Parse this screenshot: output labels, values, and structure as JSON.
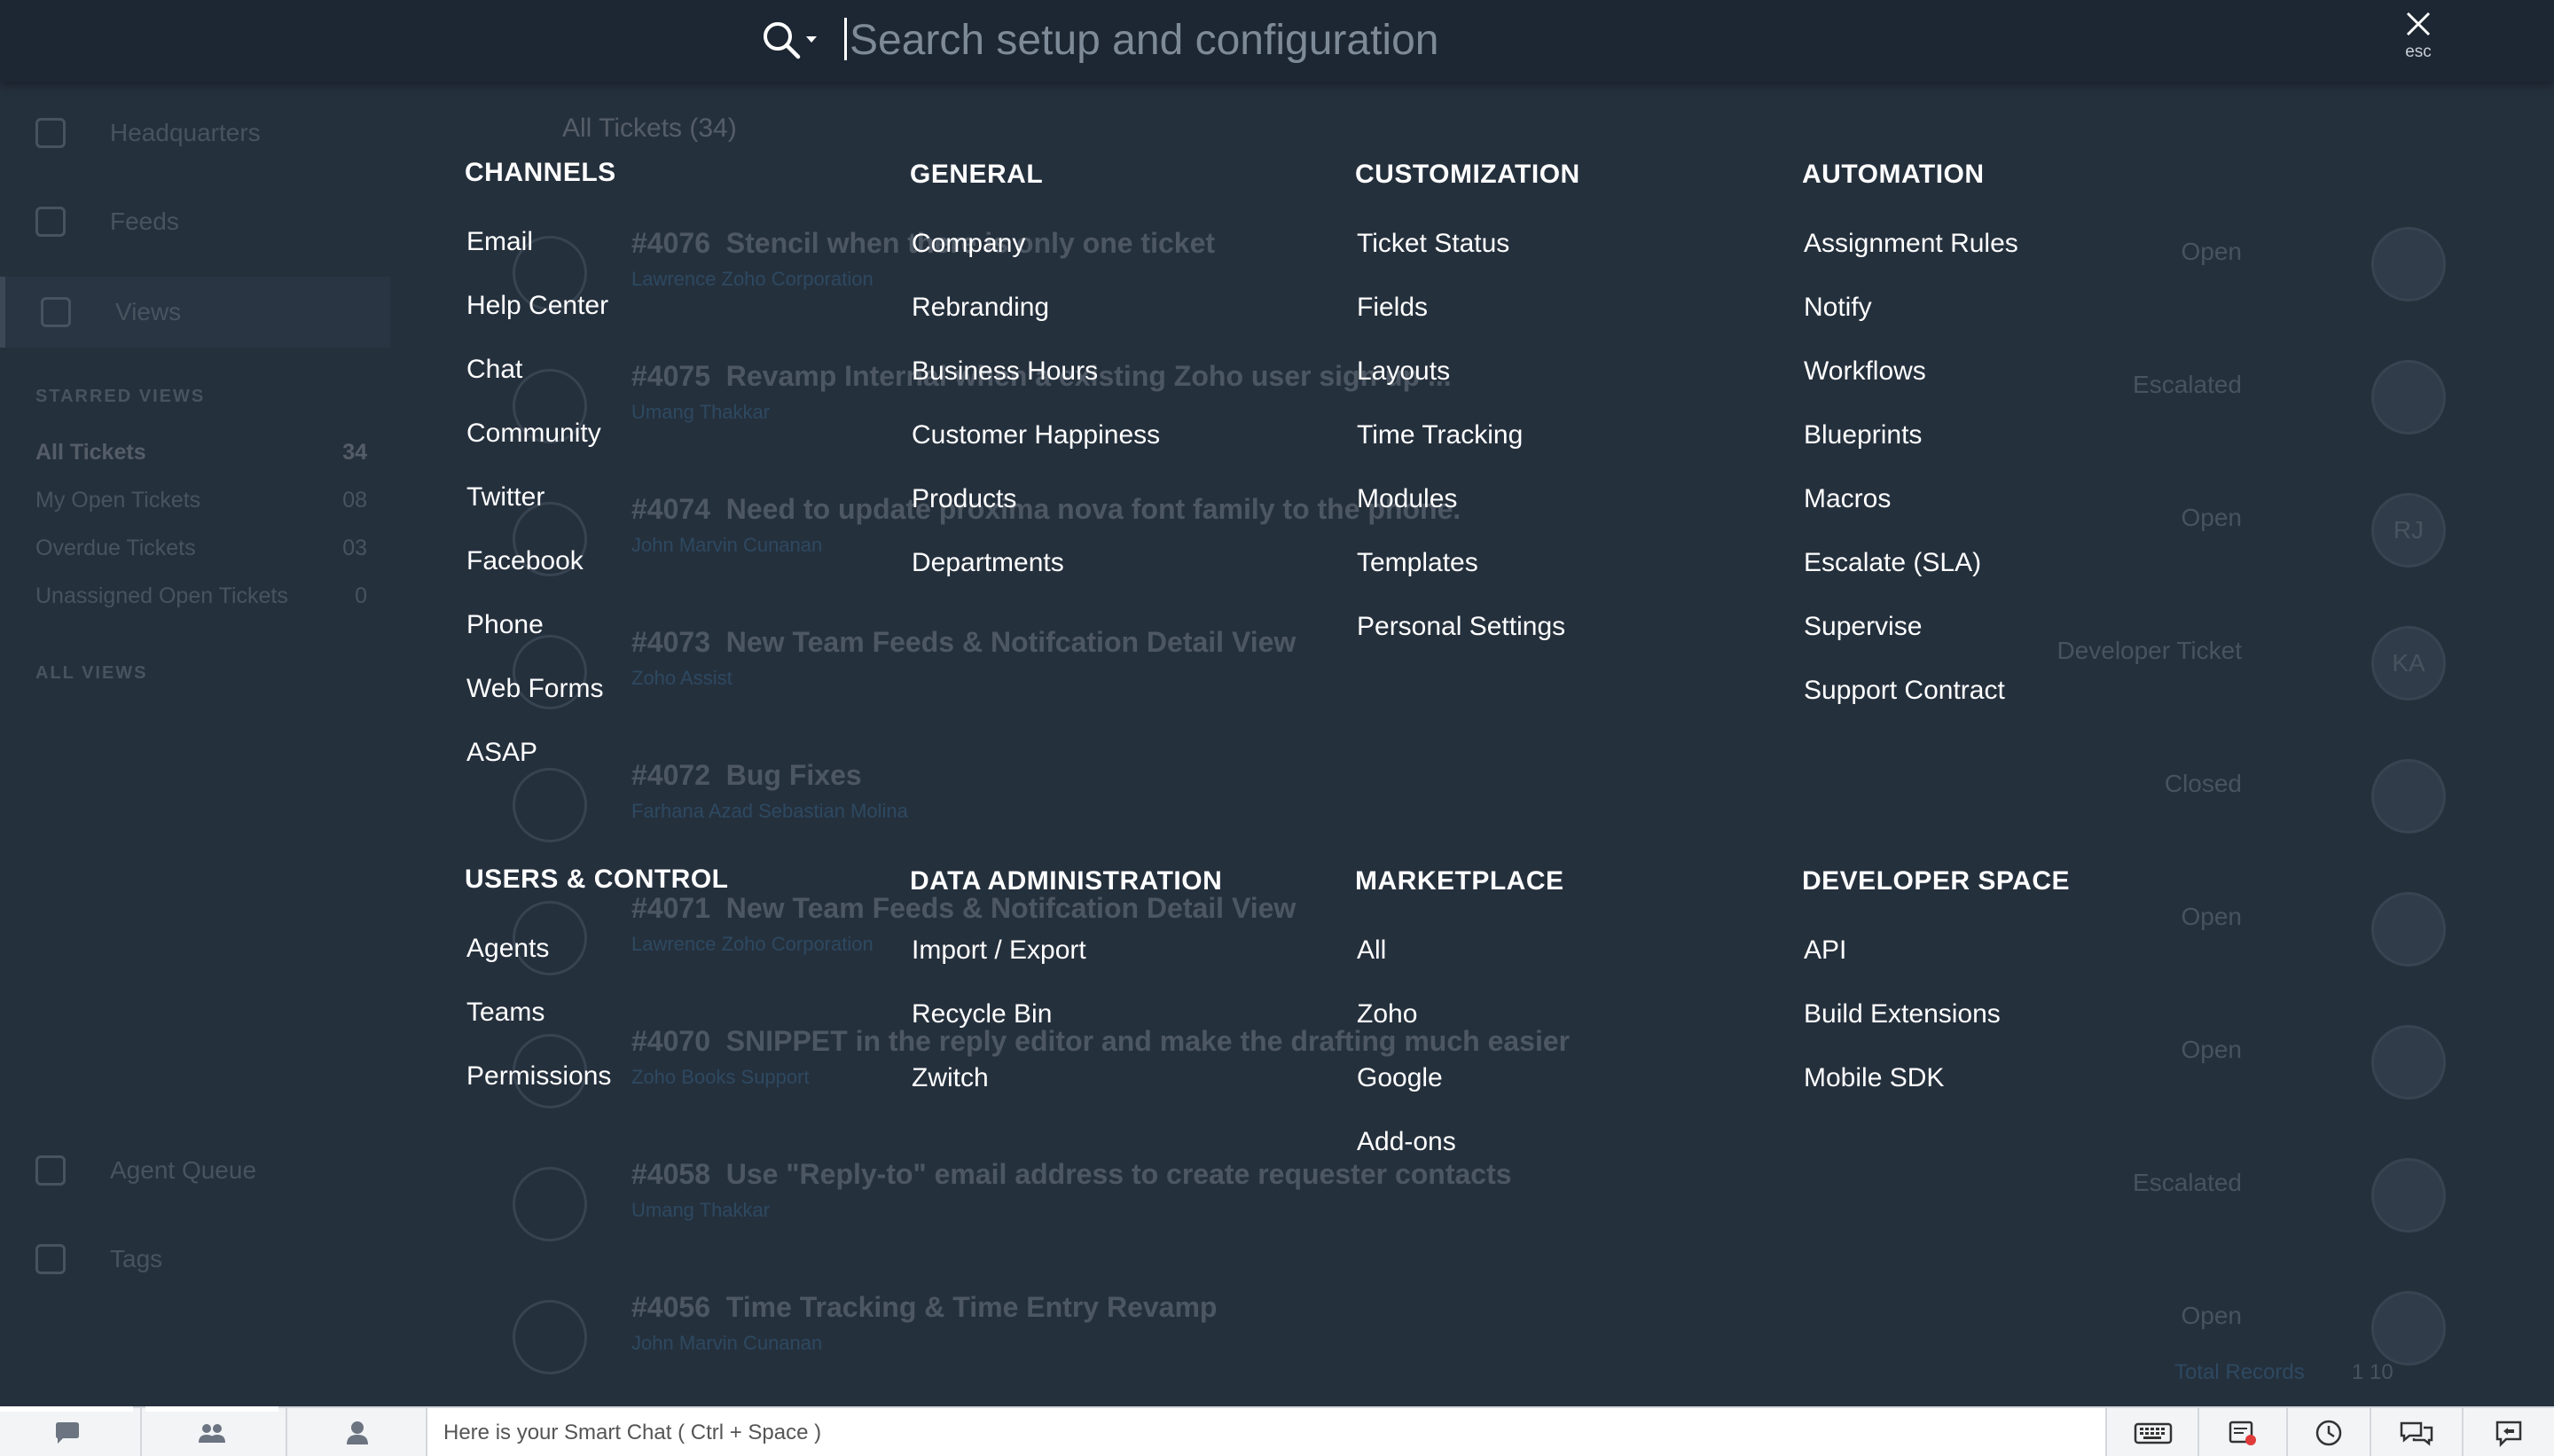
{
  "search": {
    "placeholder": "Search setup and configuration",
    "close_hint": "esc"
  },
  "background": {
    "nav": [
      "Headquarters",
      "Feeds",
      "Views"
    ],
    "starred_title": "STARRED VIEWS",
    "views": [
      {
        "label": "All Tickets",
        "count": "34"
      },
      {
        "label": "My Open Tickets",
        "count": "08"
      },
      {
        "label": "Overdue Tickets",
        "count": "03"
      },
      {
        "label": "Unassigned Open Tickets",
        "count": "0"
      }
    ],
    "all_views_title": "ALL VIEWS",
    "bottom_nav": [
      "Agent Queue",
      "Tags"
    ],
    "list_title": "All Tickets (34)",
    "tickets": [
      {
        "id": "#4076",
        "subject": "Stencil when there is only one ticket",
        "meta": "Lawrence   Zoho Corporation",
        "status": "Open",
        "avatar": ""
      },
      {
        "id": "#4075",
        "subject": "Revamp Internal when a existing Zoho user sign up ...",
        "meta": "Umang Thakkar",
        "status": "Escalated",
        "avatar": ""
      },
      {
        "id": "#4074",
        "subject": "Need to update proxima nova font family to the phone.",
        "meta": "John Marvin Cunanan",
        "status": "Open",
        "avatar": "RJ"
      },
      {
        "id": "#4073",
        "subject": "New Team Feeds & Notifcation Detail View",
        "meta": "Zoho Assist",
        "status": "Developer Ticket",
        "avatar": "KA"
      },
      {
        "id": "#4072",
        "subject": "Bug Fixes",
        "meta": "Farhana Azad   Sebastian Molina",
        "status": "Closed",
        "avatar": ""
      },
      {
        "id": "#4071",
        "subject": "New Team Feeds & Notifcation Detail View",
        "meta": "Lawrence   Zoho Corporation",
        "status": "Open",
        "avatar": ""
      },
      {
        "id": "#4070",
        "subject": "SNIPPET in the reply editor and make the drafting much easier",
        "meta": "Zoho Books Support",
        "status": "Open",
        "avatar": ""
      },
      {
        "id": "#4058",
        "subject": "Use \"Reply-to\" email address to create requester contacts",
        "meta": "Umang Thakkar",
        "status": "Escalated",
        "avatar": ""
      },
      {
        "id": "#4056",
        "subject": "Time Tracking & Time Entry Revamp",
        "meta": "John Marvin Cunanan",
        "status": "Open",
        "avatar": ""
      }
    ],
    "total_records": "Total Records",
    "page_info": "1   10"
  },
  "menu": {
    "sections": [
      {
        "title": "CHANNELS",
        "items": [
          "Email",
          "Help Center",
          "Chat",
          "Community",
          "Twitter",
          "Facebook",
          "Phone",
          "Web Forms",
          "ASAP"
        ]
      },
      {
        "title": "GENERAL",
        "items": [
          "Company",
          "Rebranding",
          "Business Hours",
          "Customer Happiness",
          "Products",
          "Departments"
        ]
      },
      {
        "title": "CUSTOMIZATION",
        "items": [
          "Ticket Status",
          "Fields",
          "Layouts",
          "Time Tracking",
          "Modules",
          "Templates",
          "Personal Settings"
        ]
      },
      {
        "title": "AUTOMATION",
        "items": [
          "Assignment Rules",
          "Notify",
          "Workflows",
          "Blueprints",
          "Macros",
          "Escalate (SLA)",
          "Supervise",
          "Support Contract"
        ]
      },
      {
        "title": "USERS & CONTROL",
        "items": [
          "Agents",
          "Teams",
          "Permissions"
        ]
      },
      {
        "title": "DATA ADMINISTRATION",
        "items": [
          "Import / Export",
          "Recycle Bin",
          "Zwitch"
        ]
      },
      {
        "title": "MARKETPLACE",
        "items": [
          "All",
          "Zoho",
          "Google",
          "Add-ons"
        ]
      },
      {
        "title": "DEVELOPER SPACE",
        "items": [
          "API",
          "Build Extensions",
          "Mobile SDK"
        ]
      }
    ]
  },
  "bottombar": {
    "smart_chat_placeholder": "Here is your Smart Chat ( Ctrl + Space )",
    "left_icons": [
      "chat-bubble-icon",
      "group-icon",
      "user-icon"
    ],
    "right_icons": [
      "keyboard-icon",
      "notification-card-icon",
      "clock-icon",
      "comments-icon",
      "feedback-icon"
    ]
  }
}
